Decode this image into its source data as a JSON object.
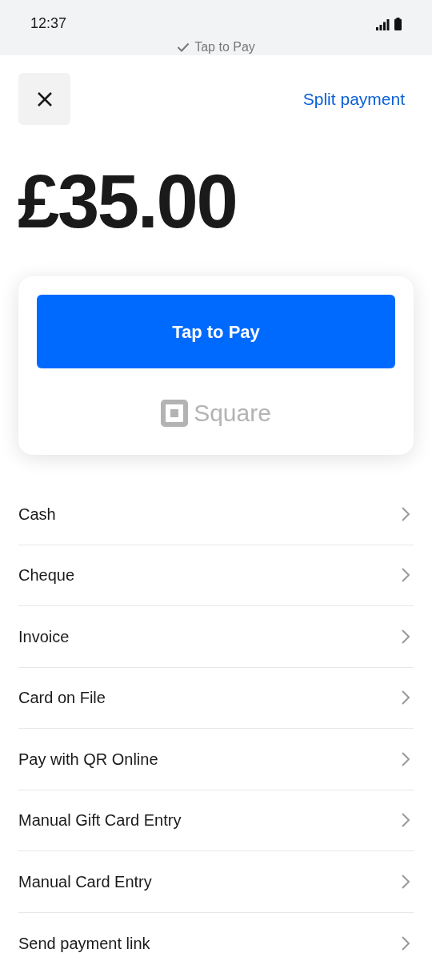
{
  "status_bar": {
    "time": "12:37",
    "banner": "Tap to Pay"
  },
  "header": {
    "action": "Split payment"
  },
  "amount": "£35.00",
  "card": {
    "button": "Tap to Pay",
    "brand": "Square"
  },
  "methods": [
    {
      "label": "Cash"
    },
    {
      "label": "Cheque"
    },
    {
      "label": "Invoice"
    },
    {
      "label": "Card on File"
    },
    {
      "label": "Pay with QR Online"
    },
    {
      "label": "Manual Gift Card Entry"
    },
    {
      "label": "Manual Card Entry"
    },
    {
      "label": "Send payment link"
    }
  ]
}
